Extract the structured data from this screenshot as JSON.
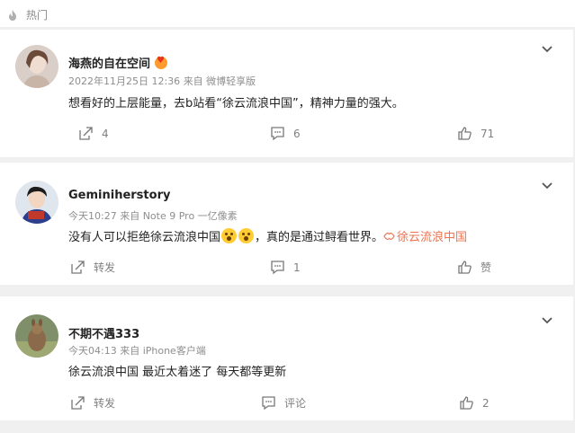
{
  "section": {
    "title": "热门"
  },
  "comments": [
    {
      "username": "海燕的自在空间",
      "timestamp": "2022年11月25日 12:36",
      "source": "来自 微博轻享版",
      "text": "想看好的上层能量，去b站看“徐云流浪中国”，精神力量的强大。",
      "repost_label": "4",
      "comment_label": "6",
      "like_label": "71"
    },
    {
      "username": "Geminiherstory",
      "timestamp": "今天10:27",
      "source": "来自 Note 9 Pro 一亿像素",
      "text_before": "没有人可以拒绝徐云流浪中国",
      "text_after": "，真的是通过鲟看世界。",
      "topic": "徐云流浪中国",
      "repost_label": "转发",
      "comment_label": "1",
      "like_label": "赞"
    },
    {
      "username": "不期不遇333",
      "timestamp": "今天04:13",
      "source": "来自 iPhone客户端",
      "text": "徐云流浪中国 最近太着迷了 每天都等更新",
      "repost_label": "转发",
      "comment_label": "评论",
      "like_label": "2"
    }
  ],
  "colors": {
    "accent": "#eb7350",
    "muted": "#808080",
    "background": "#f0f0f0"
  },
  "icons": [
    "flame-icon",
    "chevron-down-icon",
    "repost-icon",
    "comment-icon",
    "like-icon",
    "topic-icon"
  ]
}
